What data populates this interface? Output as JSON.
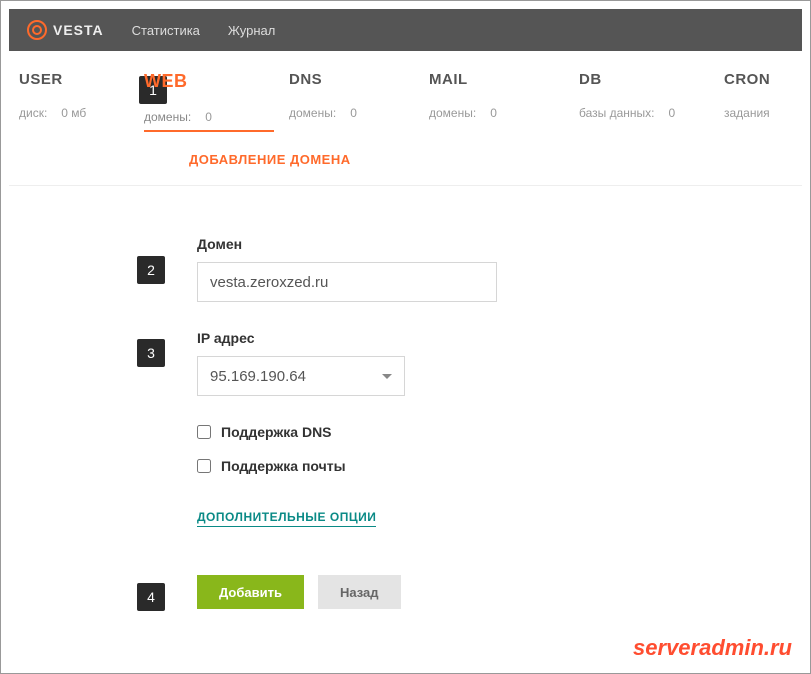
{
  "brand": "VESTA",
  "topnav": {
    "stats": "Статистика",
    "log": "Журнал"
  },
  "tabs": {
    "user": {
      "title": "USER",
      "sub_label": "диск:",
      "sub_value": "0 мб"
    },
    "web": {
      "title": "WEB",
      "sub_label": "домены:",
      "sub_value": "0"
    },
    "dns": {
      "title": "DNS",
      "sub_label": "домены:",
      "sub_value": "0"
    },
    "mail": {
      "title": "MAIL",
      "sub_label": "домены:",
      "sub_value": "0"
    },
    "db": {
      "title": "DB",
      "sub_label": "базы данных:",
      "sub_value": "0"
    },
    "cron": {
      "title": "CRON",
      "sub_label": "задания",
      "sub_value": ""
    }
  },
  "subaction": "ДОБАВЛЕНИЕ ДОМЕНА",
  "badges": {
    "b1": "1",
    "b2": "2",
    "b3": "3",
    "b4": "4"
  },
  "form": {
    "domain_label": "Домен",
    "domain_value": "vesta.zeroxzed.ru",
    "ip_label": "IP адрес",
    "ip_value": "95.169.190.64",
    "dns_support": "Поддержка DNS",
    "mail_support": "Поддержка почты",
    "advanced": "ДОПОЛНИТЕЛЬНЫЕ ОПЦИИ",
    "submit": "Добавить",
    "back": "Назад"
  },
  "watermark": "serveradmin.ru"
}
